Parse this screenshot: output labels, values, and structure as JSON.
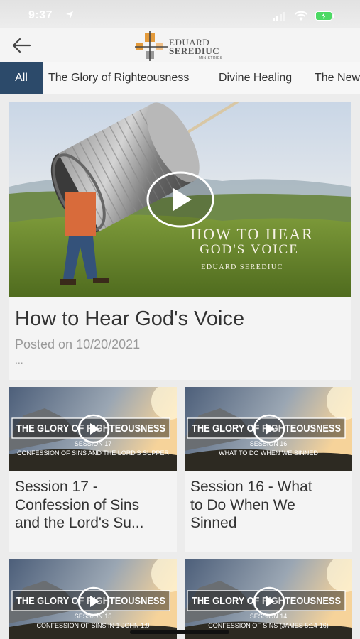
{
  "status_bar": {
    "time": "9:37"
  },
  "header": {
    "logo_line1": "EDUARD",
    "logo_line2": "SEREDIUC",
    "logo_line3": "MINISTRIES"
  },
  "tabs": [
    {
      "label": "All",
      "active": true
    },
    {
      "label": "The Glory of Righteousness",
      "active": false
    },
    {
      "label": "Divine Healing",
      "active": false
    },
    {
      "label": "The New",
      "active": false
    }
  ],
  "featured": {
    "image_text_line1": "HOW TO HEAR",
    "image_text_line2": "GOD'S VOICE",
    "image_text_author": "EDUARD SEREDIUC",
    "title": "How to Hear God's Voice",
    "date": "Posted on 10/20/2021",
    "more": "..."
  },
  "cards": [
    {
      "banner": "THE GLORY OF RIGHTEOUSNESS",
      "session": "SESSION 17",
      "subtitle": "CONFESSION OF SINS AND THE LORD'S SUPPER",
      "title_lines": [
        "Session 17 -",
        "Confession of Sins",
        "and the Lord's Su..."
      ]
    },
    {
      "banner": "THE GLORY OF RIGHTEOUSNESS",
      "session": "SESSION 16",
      "subtitle": "WHAT TO DO WHEN WE SINNED",
      "title_lines": [
        "Session 16 - What",
        "to Do When We",
        "Sinned"
      ]
    },
    {
      "banner": "THE GLORY OF RIGHTEOUSNESS",
      "session": "SESSION 15",
      "subtitle": "CONFESSION OF SINS IN 1 JOHN 1:9",
      "title_lines": []
    },
    {
      "banner": "THE GLORY OF RIGHTEOUSNESS",
      "session": "SESSION 14",
      "subtitle": "CONFESSION OF SINS (JAMES 5:14-16)",
      "title_lines": []
    }
  ],
  "colors": {
    "accent": "#2c4a6a",
    "logo_orange": "#e39a3b",
    "background": "#ececec"
  },
  "icons": [
    "location-arrow-icon",
    "signal-icon",
    "wifi-icon",
    "battery-icon",
    "back-arrow-icon",
    "play-icon"
  ]
}
